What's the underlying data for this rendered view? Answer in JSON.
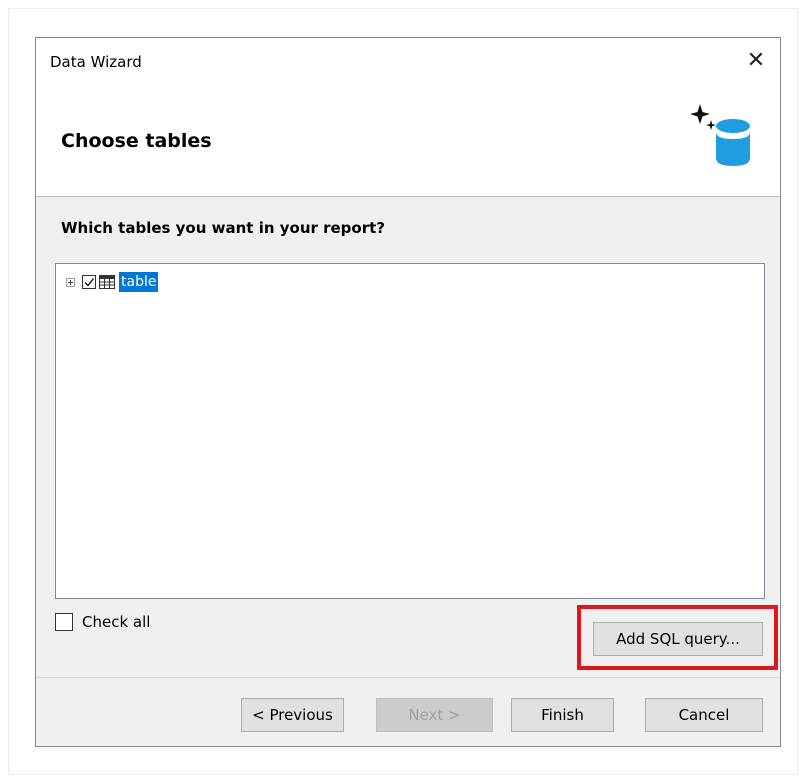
{
  "window": {
    "title": "Data Wizard",
    "close_glyph": "✕"
  },
  "header": {
    "heading": "Choose tables",
    "icon": "database-sparkle-icon"
  },
  "content": {
    "question": "Which tables you want in your report?",
    "tree": {
      "items": [
        {
          "label": "table",
          "checked": true,
          "expanded": false,
          "selected": true
        }
      ]
    },
    "check_all": {
      "label": "Check all",
      "checked": false
    },
    "add_sql_button": "Add SQL query..."
  },
  "footer": {
    "previous_button": "< Previous",
    "next_button": "Next >",
    "finish_button": "Finish",
    "cancel_button": "Cancel"
  },
  "colors": {
    "selection": "#0078d7",
    "highlight_frame": "#e0161f",
    "db_icon": "#1f9de0"
  }
}
